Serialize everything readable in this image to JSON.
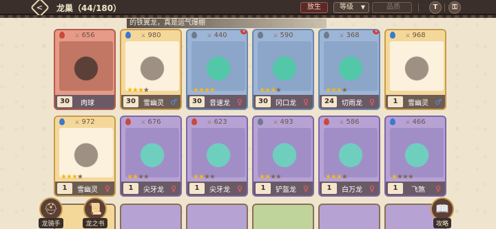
{
  "header": {
    "title": "龙巢（44/180）",
    "release_label": "放生",
    "sort_label": "等级",
    "filter_placeholder": "品质",
    "help_label": "T",
    "lock_label": "🔒"
  },
  "toast": {
    "text": "的铁翼龙，真是运气爆棚"
  },
  "row1": [
    {
      "power": "656",
      "level": "30",
      "name": "肉球",
      "gender": "",
      "stars": 0,
      "color": "red",
      "elem_color": "#c94a3a",
      "alert": false
    },
    {
      "power": "980",
      "level": "30",
      "name": "雪幽灵",
      "gender": "♂",
      "gender_class": "m",
      "stars": 3,
      "color": "gold",
      "elem_color": "#3a79d0",
      "alert": false
    },
    {
      "power": "440",
      "level": "30",
      "name": "音速龙",
      "gender": "♀",
      "gender_class": "f",
      "stars": 4,
      "color": "blue",
      "elem_color": "#6d7b8a",
      "alert": true
    },
    {
      "power": "590",
      "level": "30",
      "name": "冈口龙",
      "gender": "♀",
      "gender_class": "f",
      "stars": 3,
      "color": "blue",
      "elem_color": "#6d7b8a",
      "alert": false
    },
    {
      "power": "368",
      "level": "24",
      "name": "切雨龙",
      "gender": "♀",
      "gender_class": "f",
      "stars": 3,
      "color": "blue",
      "elem_color": "#6d7b8a",
      "alert": true
    },
    {
      "power": "968",
      "level": "1",
      "name": "雪幽灵",
      "gender": "♂",
      "gender_class": "m",
      "stars": 0,
      "color": "gold",
      "elem_color": "#3a79d0",
      "alert": false
    }
  ],
  "row2": [
    {
      "power": "972",
      "level": "1",
      "name": "雪幽灵",
      "gender": "♀",
      "gender_class": "f",
      "stars": 3,
      "color": "gold",
      "elem_color": "#3a79d0",
      "alert": false
    },
    {
      "power": "676",
      "level": "1",
      "name": "尖牙龙",
      "gender": "♀",
      "gender_class": "f",
      "stars": 2,
      "color": "purple",
      "elem_color": "#c94a3a",
      "alert": false
    },
    {
      "power": "623",
      "level": "1",
      "name": "尖牙龙",
      "gender": "♀",
      "gender_class": "f",
      "stars": 2,
      "color": "purple",
      "elem_color": "#c94a3a",
      "alert": false
    },
    {
      "power": "493",
      "level": "1",
      "name": "铲盔龙",
      "gender": "♀",
      "gender_class": "f",
      "stars": 2,
      "color": "purple",
      "elem_color": "#6d7b8a",
      "alert": false
    },
    {
      "power": "586",
      "level": "1",
      "name": "白万龙",
      "gender": "♀",
      "gender_class": "f",
      "stars": 3,
      "color": "purple",
      "elem_color": "#c94a3a",
      "alert": false
    },
    {
      "power": "466",
      "level": "1",
      "name": "飞煞",
      "gender": "♀",
      "gender_class": "f",
      "stars": 1,
      "color": "purple",
      "elem_color": "#3a79d0",
      "alert": false
    }
  ],
  "bottom": {
    "rider_label": "龙骑手",
    "book_label": "龙之书",
    "guide_label": "攻略"
  }
}
